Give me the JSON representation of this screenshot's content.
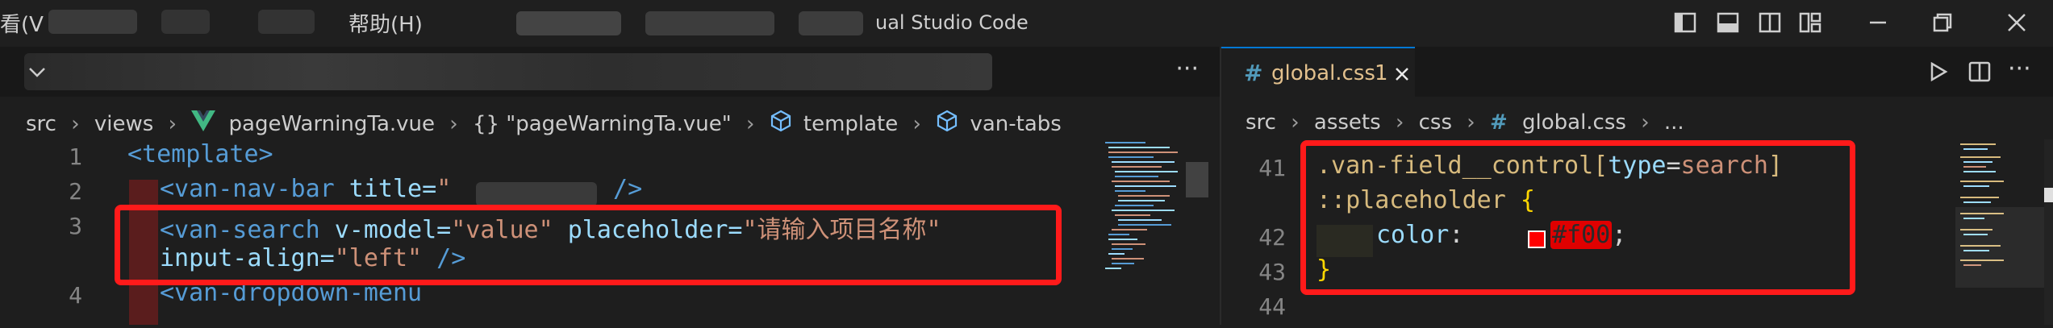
{
  "titlebar": {
    "menu_view": "看(V",
    "menu_help": "帮助(H)",
    "app_title": "ual Studio Code"
  },
  "left_editor": {
    "more_label": "···",
    "breadcrumb": [
      "src",
      "views",
      "pageWarningTa.vue",
      "{} \"pageWarningTa.vue\"",
      "template",
      "van-tabs"
    ],
    "lines": [
      {
        "num": "1"
      },
      {
        "num": "2"
      },
      {
        "num": "3"
      },
      {
        "num": "4"
      }
    ],
    "code": {
      "l1_tag": "<template>",
      "l2_open": "<van-nav-bar",
      "l2_attr": " title=",
      "l2_str": "\"",
      "l2_close": " />",
      "l3_open": "<van-search",
      "l3_attr1": " v-model=",
      "l3_val1": "\"value\"",
      "l3_attr2": " placeholder=",
      "l3_val2": "\"请输入项目名称\"",
      "l3b_attr": "input-align=",
      "l3b_val": "\"left\"",
      "l3b_close": " />",
      "l4_tag": "<van-dropdown-menu"
    }
  },
  "right_editor": {
    "tab_icon": "#",
    "tab_name": "global.css",
    "tab_badge": "1",
    "breadcrumb": [
      "src",
      "assets",
      "css",
      "global.css",
      "..."
    ],
    "breadcrumb_hash": "#",
    "lines": {
      "n41": "41",
      "n42": "42",
      "n43": "43",
      "n44": "44"
    },
    "code": {
      "sel1": ".van-field__control[",
      "attr": "type",
      "eq": "=",
      "attrval": "search",
      "sel1_end": "]",
      "sel2": "::placeholder",
      "brace_open": " {",
      "prop": "color",
      "colon": ": ",
      "value": "#f00",
      "semi": ";",
      "brace_close": "}"
    },
    "swatch_color": "#ff0000"
  },
  "colors": {
    "accent": "#0078d4",
    "highlight_box": "#ff1a1a"
  }
}
